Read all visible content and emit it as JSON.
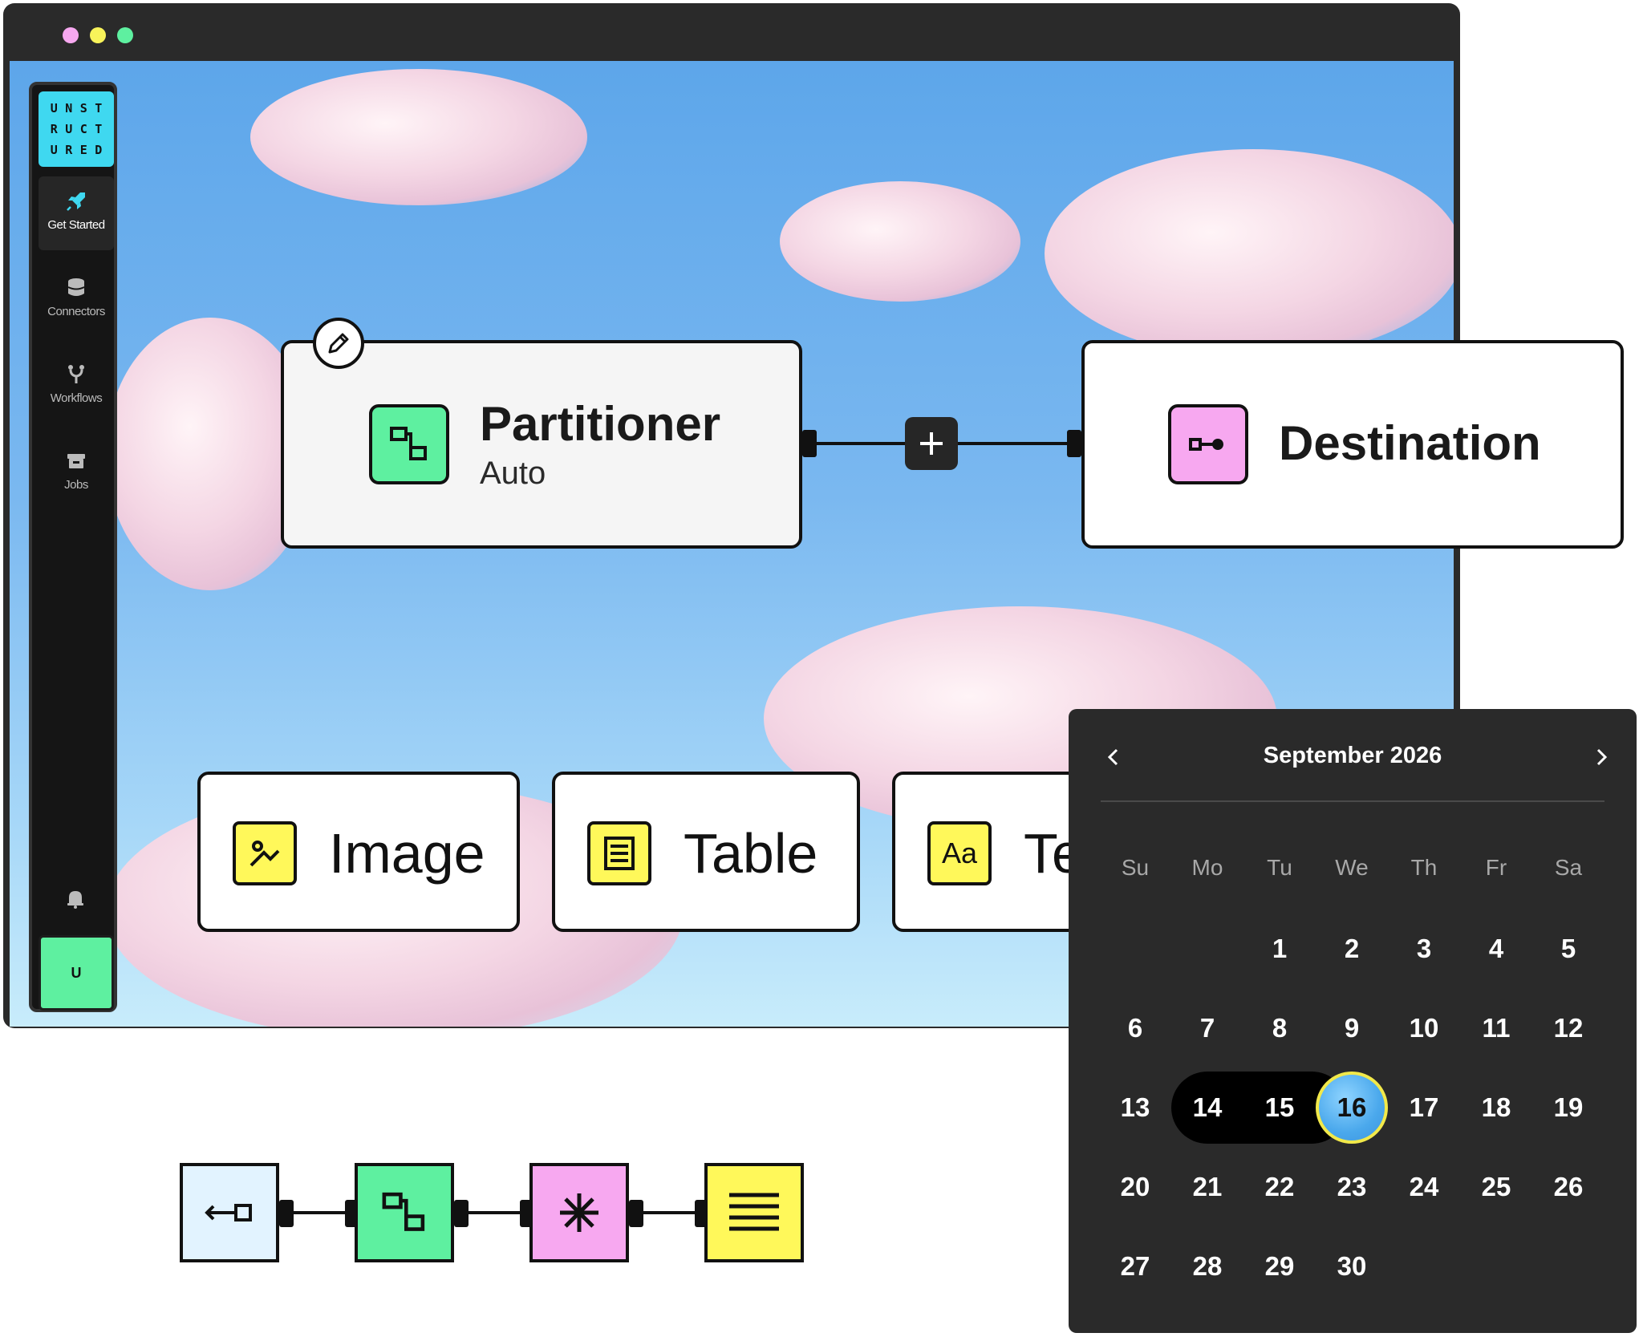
{
  "window": {
    "traffic_lights": [
      "close",
      "minimize",
      "maximize"
    ]
  },
  "sidebar": {
    "logo_letters": [
      "U",
      "N",
      "S",
      "T",
      "R",
      "U",
      "C",
      "T",
      "U",
      "R",
      "E",
      "D"
    ],
    "items": [
      {
        "label": "Get Started",
        "icon": "rocket-icon",
        "active": true
      },
      {
        "label": "Connectors",
        "icon": "database-icon",
        "active": false
      },
      {
        "label": "Workflows",
        "icon": "workflow-icon",
        "active": false
      },
      {
        "label": "Jobs",
        "icon": "jobs-icon",
        "active": false
      }
    ],
    "notification_icon": "bell-icon",
    "avatar_initial": "U"
  },
  "workflow": {
    "partitioner": {
      "title": "Partitioner",
      "subtitle": "Auto",
      "icon": "partition-icon",
      "color": "#5ef0a0"
    },
    "add_button_icon": "plus-icon",
    "edit_icon": "pencil-icon",
    "destination": {
      "title": "Destination",
      "icon": "destination-icon",
      "color": "#f7a8f0"
    }
  },
  "element_types": [
    {
      "label": "Image",
      "icon": "image-icon"
    },
    {
      "label": "Table",
      "icon": "table-icon"
    },
    {
      "label": "Te",
      "icon": "text-icon",
      "icon_text": "Aa"
    }
  ],
  "calendar": {
    "month_label": "September 2026",
    "weekdays": [
      "Su",
      "Mo",
      "Tu",
      "We",
      "Th",
      "Fr",
      "Sa"
    ],
    "days": [
      "1",
      "2",
      "3",
      "4",
      "5",
      "6",
      "7",
      "8",
      "9",
      "10",
      "11",
      "12",
      "13",
      "14",
      "15",
      "16",
      "17",
      "18",
      "19",
      "20",
      "21",
      "22",
      "23",
      "24",
      "25",
      "26",
      "27",
      "28",
      "29",
      "30"
    ],
    "range_start": "14",
    "selected": "16"
  },
  "pipeline": {
    "steps": [
      {
        "icon": "source-icon",
        "color": "#e2f3ff"
      },
      {
        "icon": "partition-icon",
        "color": "#5ef0a0"
      },
      {
        "icon": "asterisk-icon",
        "color": "#f7a8f0"
      },
      {
        "icon": "lines-icon",
        "color": "#fff85a"
      }
    ]
  },
  "colors": {
    "accent_green": "#5ef0a0",
    "accent_pink": "#f7a8f0",
    "accent_yellow": "#fff85a",
    "accent_cyan": "#3fd8f0",
    "dark": "#2a2a2a"
  }
}
